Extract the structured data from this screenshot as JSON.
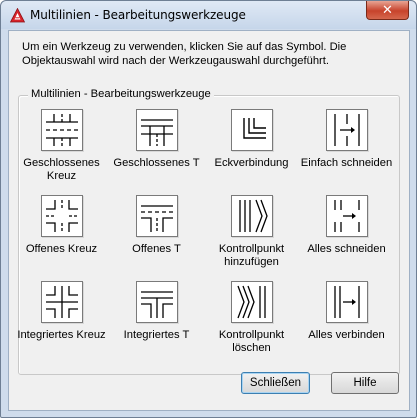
{
  "window": {
    "title": "Multilinien - Bearbeitungswerkzeuge",
    "close_glyph": "✕"
  },
  "instruction": "Um ein Werkzeug zu verwenden, klicken Sie auf das Symbol. Die Objektauswahl wird nach der Werkzeugauswahl durchgeführt.",
  "group": {
    "title": "Multilinien - Bearbeitungswerkzeuge"
  },
  "tools": [
    {
      "label": "Geschlossenes Kreuz",
      "icon": "closed-cross-icon"
    },
    {
      "label": "Geschlossenes T",
      "icon": "closed-tee-icon"
    },
    {
      "label": "Eckverbindung",
      "icon": "corner-joint-icon"
    },
    {
      "label": "Einfach schneiden",
      "icon": "cut-single-icon"
    },
    {
      "label": "Offenes Kreuz",
      "icon": "open-cross-icon"
    },
    {
      "label": "Offenes T",
      "icon": "open-tee-icon"
    },
    {
      "label": "Kontrollpunkt hinzufügen",
      "icon": "add-vertex-icon"
    },
    {
      "label": "Alles schneiden",
      "icon": "cut-all-icon"
    },
    {
      "label": "Integriertes Kreuz",
      "icon": "merged-cross-icon"
    },
    {
      "label": "Integriertes T",
      "icon": "merged-tee-icon"
    },
    {
      "label": "Kontrollpunkt löschen",
      "icon": "delete-vertex-icon"
    },
    {
      "label": "Alles verbinden",
      "icon": "weld-all-icon"
    }
  ],
  "buttons": {
    "close": "Schließen",
    "help": "Hilfe"
  },
  "colors": {
    "title_bar": "#c6d6ea",
    "close_button": "#c7432c",
    "dialog_bg": "#f0f0f0",
    "app_icon": "#d8232a"
  }
}
